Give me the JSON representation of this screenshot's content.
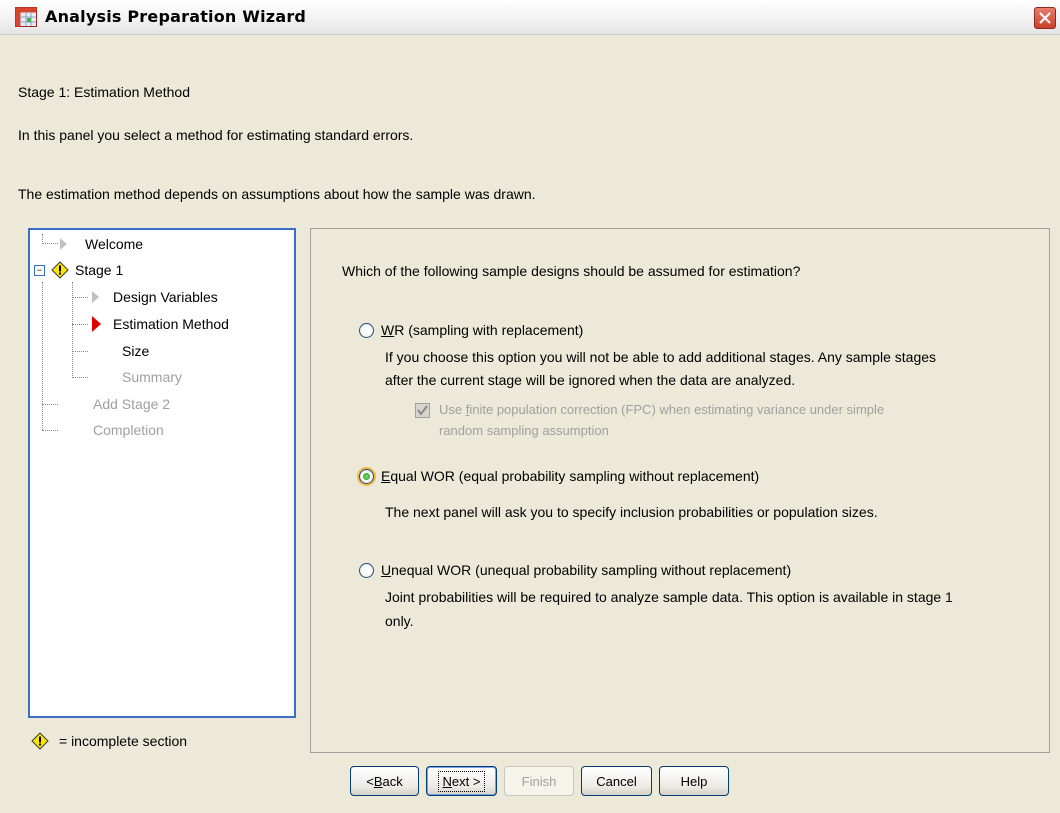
{
  "window": {
    "title": "Analysis Preparation Wizard",
    "close_glyph": "✕"
  },
  "header": {
    "stage": "Stage 1: Estimation Method",
    "intro": "In this panel you select a method for estimating standard errors.",
    "note": "The estimation method depends on assumptions about how the sample was drawn."
  },
  "nav": {
    "items": [
      {
        "label": "Welcome",
        "state": "normal"
      },
      {
        "label": "Stage 1",
        "state": "incomplete",
        "expanded_glyph": "−"
      },
      {
        "label": "Design Variables",
        "state": "normal"
      },
      {
        "label": "Estimation Method",
        "state": "current"
      },
      {
        "label": "Size",
        "state": "normal"
      },
      {
        "label": "Summary",
        "state": "disabled"
      },
      {
        "label": "Add Stage 2",
        "state": "disabled"
      },
      {
        "label": "Completion",
        "state": "disabled"
      }
    ],
    "legend": "= incomplete section",
    "warning_glyph": "!"
  },
  "content": {
    "question": "Which of the following sample designs should be assumed for estimation?",
    "options": [
      {
        "mnemonic": "W",
        "label_rest": "R (sampling with replacement)",
        "selected": false,
        "description": [
          "If you choose this option you will not be able to add additional stages. Any sample stages",
          "after the current stage will be ignored when the data are analyzed."
        ],
        "fpc": {
          "prefix": "Use ",
          "mnemonic": "f",
          "rest": "inite population correction (FPC) when estimating variance under simple",
          "line2": "random sampling assumption",
          "checked": true,
          "enabled": false
        }
      },
      {
        "mnemonic": "E",
        "label_rest": "qual WOR (equal probability sampling without replacement)",
        "selected": true,
        "description": [
          "The next panel will ask you to specify inclusion probabilities or population sizes."
        ]
      },
      {
        "mnemonic": "U",
        "label_rest": "nequal WOR (unequal probability sampling without replacement)",
        "selected": false,
        "description": [
          "Joint probabilities will be required to analyze sample data. This option is available in stage 1",
          "only."
        ]
      }
    ]
  },
  "buttons": {
    "back_prefix": "< ",
    "back_mnemonic": "B",
    "back_rest": "ack",
    "next_mnemonic": "N",
    "next_rest": "ext >",
    "finish": "Finish",
    "cancel": "Cancel",
    "help": "Help"
  }
}
